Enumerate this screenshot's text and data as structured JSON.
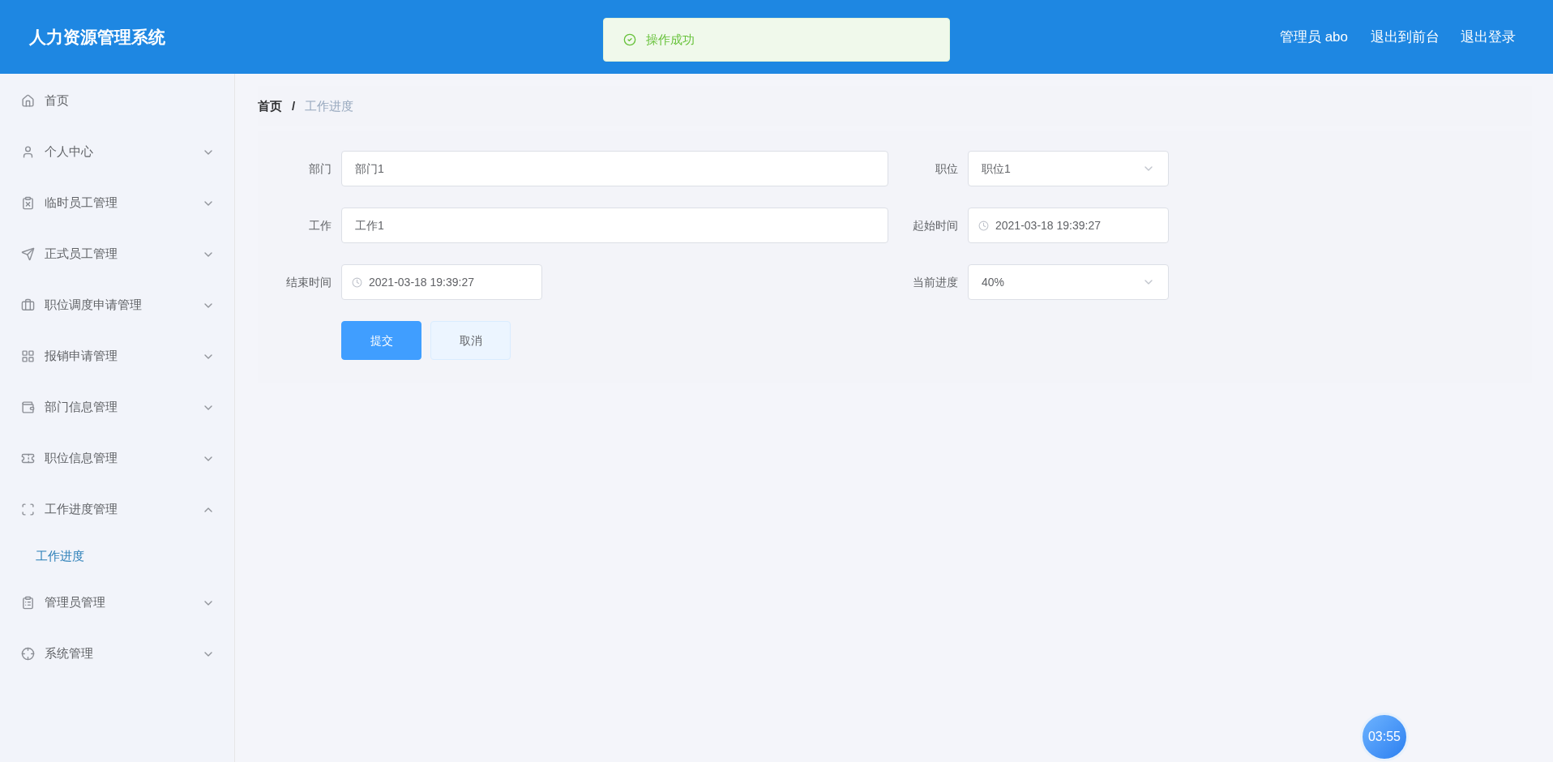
{
  "header": {
    "title": "人力资源管理系统",
    "user": "管理员 abo",
    "links": [
      "退出到前台",
      "退出登录"
    ]
  },
  "toast": {
    "text": "操作成功",
    "kind": "success"
  },
  "sidebar": {
    "items": [
      {
        "label": "首页"
      },
      {
        "label": "个人中心",
        "expanded": false
      },
      {
        "label": "临时员工管理",
        "expanded": false
      },
      {
        "label": "正式员工管理",
        "expanded": false
      },
      {
        "label": "职位调度申请管理",
        "expanded": false
      },
      {
        "label": "报销申请管理",
        "expanded": false
      },
      {
        "label": "部门信息管理",
        "expanded": false
      },
      {
        "label": "职位信息管理",
        "expanded": false
      },
      {
        "label": "工作进度管理",
        "expanded": true,
        "children": [
          {
            "label": "工作进度",
            "selected": true
          }
        ]
      },
      {
        "label": "管理员管理",
        "expanded": false
      },
      {
        "label": "系统管理",
        "expanded": false
      }
    ]
  },
  "breadcrumb": {
    "items": [
      "首页",
      "工作进度"
    ],
    "separator": "/"
  },
  "form": {
    "fields": [
      {
        "label": "部门",
        "value": "部门1",
        "kind": "text"
      },
      {
        "label": "职位",
        "value": "职位1",
        "kind": "select"
      },
      {
        "label": "工作",
        "value": "工作1",
        "kind": "text"
      },
      {
        "label": "起始时间",
        "value": "2021-03-18 19:39:27",
        "kind": "datetime"
      },
      {
        "label": "结束时间",
        "value": "2021-03-18 19:39:27",
        "kind": "datetime"
      },
      {
        "label": "当前进度",
        "value": "40%",
        "kind": "select"
      }
    ],
    "buttons": [
      {
        "label": "提交",
        "kind": "primary"
      },
      {
        "label": "取消",
        "kind": "default"
      }
    ]
  },
  "timer": "03:55"
}
